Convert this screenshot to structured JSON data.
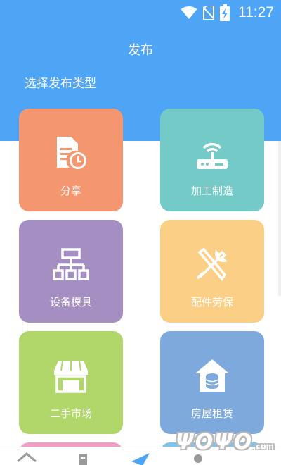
{
  "status_bar": {
    "time": "11:27",
    "icons": [
      "wifi-icon",
      "no-sim-icon",
      "battery-charging-icon"
    ]
  },
  "header": {
    "title": "发布",
    "subtitle": "选择发布类型"
  },
  "categories": [
    {
      "label": "分享",
      "icon": "document-clock-icon",
      "color": "#f4966f"
    },
    {
      "label": "加工制造",
      "icon": "router-icon",
      "color": "#74cac6"
    },
    {
      "label": "设备模具",
      "icon": "org-chart-icon",
      "color": "#a58ec2"
    },
    {
      "label": "配件劳保",
      "icon": "tools-icon",
      "color": "#fbcf86"
    },
    {
      "label": "二手市场",
      "icon": "store-icon",
      "color": "#b1d669"
    },
    {
      "label": "房屋租赁",
      "icon": "house-coins-icon",
      "color": "#7ea9dd"
    }
  ],
  "partial_cards": {
    "left_color": "#ef9fc6",
    "right_color": "#7ec3ec"
  },
  "bottom_nav": {
    "icons": [
      "home-icon",
      "list-icon",
      "send-icon",
      "user-icon"
    ],
    "accent": "#4ea5f6"
  },
  "watermark": {
    "text": "ΨΟΨΟ",
    "suffix": ".com"
  },
  "colors": {
    "header_background": "#4ea5f6"
  }
}
